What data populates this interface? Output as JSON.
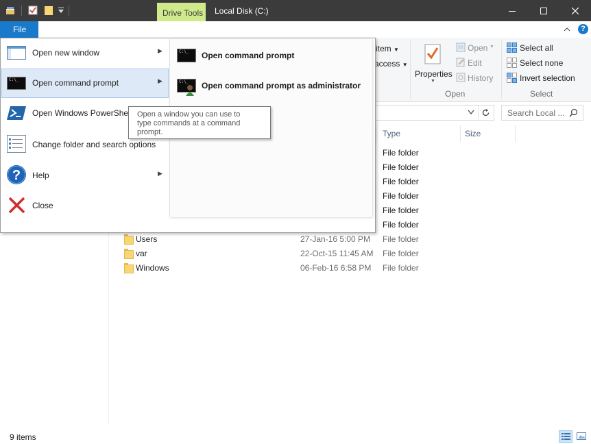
{
  "titlebar": {
    "context_tab": "Drive Tools",
    "title": "Local Disk (C:)",
    "minimize_glyph": "—",
    "maximize_glyph": "☐",
    "close_glyph": "✕"
  },
  "ribbon_tabs": {
    "file_tab": "File",
    "help_glyph": "?",
    "collapse_glyph": "˄"
  },
  "ribbon": {
    "item_dropdown": "item",
    "access_dropdown": "access",
    "properties": "Properties",
    "open": "Open",
    "edit": "Edit",
    "history": "History",
    "open_group": "Open",
    "select_all": "Select all",
    "select_none": "Select none",
    "invert_selection": "Invert selection",
    "select_group": "Select"
  },
  "address": {
    "search_placeholder": "Search Local ..."
  },
  "columns": {
    "type": "Type",
    "size": "Size"
  },
  "files_partial": [
    {
      "type": "File folder"
    },
    {
      "type": "File folder"
    },
    {
      "type": "File folder"
    },
    {
      "type": "File folder"
    },
    {
      "type": "File folder"
    },
    {
      "type": "File folder"
    }
  ],
  "files": [
    {
      "name": "Users",
      "date": "27-Jan-16 5:00 PM",
      "type": "File folder"
    },
    {
      "name": "var",
      "date": "22-Oct-15 11:45 AM",
      "type": "File folder"
    },
    {
      "name": "Windows",
      "date": "06-Feb-16 6:58 PM",
      "type": "File folder"
    }
  ],
  "file_menu": {
    "items": [
      {
        "label": "Open new window"
      },
      {
        "label": "Open command prompt"
      },
      {
        "label": "Open Windows PowerShell"
      },
      {
        "label": "Change folder and search options"
      },
      {
        "label": "Help"
      },
      {
        "label": "Close"
      }
    ],
    "submenu": [
      {
        "label": "Open command prompt"
      },
      {
        "label": "Open command prompt as administrator"
      }
    ],
    "cmd_icon_text": "C:\\_"
  },
  "tooltip": {
    "line1": "Open a window you can use to",
    "line2": "type commands at a command",
    "line3": "prompt."
  },
  "status": {
    "item_count": "9 items"
  }
}
